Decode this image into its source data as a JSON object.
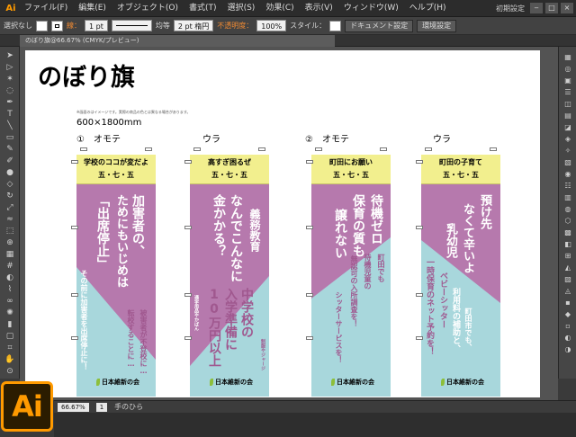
{
  "menubar": {
    "app_icon": "Ai",
    "items": [
      "ファイル(F)",
      "編集(E)",
      "オブジェクト(O)",
      "書式(T)",
      "選択(S)",
      "効果(C)",
      "表示(V)",
      "ウィンドウ(W)",
      "ヘルプ(H)"
    ],
    "workspace": "初期設定",
    "window_buttons": [
      "‒",
      "□",
      "×"
    ]
  },
  "controlbar": {
    "selection": "選択なし",
    "stroke_label": "線：",
    "stroke_weight": "1 pt",
    "profile": "均等",
    "brush": "2 pt 楕円",
    "opacity_label": "不透明度：",
    "opacity_value": "100%",
    "style_label": "スタイル：",
    "doc_settings": "ドキュメント設定",
    "env_settings": "環境設定"
  },
  "document": {
    "tab_title": "のぼり旗@66.67% (CMYK/プレビュー)"
  },
  "artboard": {
    "title": "のぼり旗",
    "note": "※画面のはイメージです。実際の商品の色とは異なる場合があります。",
    "size": "600×1800mm",
    "pairs": [
      {
        "num": "①",
        "front": "オモテ",
        "back": "ウラ"
      },
      {
        "num": "②",
        "front": "オモテ",
        "back": "ウラ"
      }
    ],
    "banners": [
      {
        "header1": "学校のココが変だよ",
        "header2": "五・七・五",
        "cols_white": [
          "加害者の、",
          "ためにもいじめは",
          "「出席停止」"
        ],
        "cols_bottom": [
          "その前に加害者を出席停止に！"
        ],
        "cols_pink": [
          "被害者が不登校に…",
          "転校することに…"
        ],
        "logo": "日本維新の会"
      },
      {
        "header1": "高すぎ困るぜ",
        "header2": "五・七・五",
        "cols_white": [
          "義務教育",
          "なんでこんなに",
          "金かかる？"
        ],
        "cols_bottom": [
          "中学校の",
          "入学準備に",
          "10万円以上"
        ],
        "small_left": "通学用品やかばん",
        "small_right": "制服やジャージ",
        "logo": "日本維新の会"
      },
      {
        "header1": "町田にお願い",
        "header2": "五・七・五",
        "cols_white": [
          "待機ゼロ",
          "保育の質も",
          "譲れない"
        ],
        "cols_pink": [
          "町田でも",
          "待機児童の",
          "無認可の入所調査を！"
        ],
        "cols_bottom": [
          "シッターサービスを！"
        ],
        "logo": "日本維新の会"
      },
      {
        "header1": "町田の子育て",
        "header2": "五・七・五",
        "cols_white": [
          "預け先",
          "なくて辛いよ",
          "乳幼児"
        ],
        "cols_bottom": [
          "一時保育のネット予約を！",
          "ベビーシッター",
          "利用料の補助と、"
        ],
        "cols_pink": [
          "町田市でも、"
        ],
        "logo": "日本維新の会"
      }
    ]
  },
  "statusbar": {
    "zoom": "66.67%",
    "page": "1",
    "tool": "手のひら"
  },
  "colors": {
    "banner_purple": "#b679ad",
    "banner_cyan": "#a8d7dc",
    "banner_yellow": "#f2ef8e",
    "ai_orange": "#ff9a00"
  },
  "icons": {
    "tools": [
      "selection-icon",
      "direct-selection-icon",
      "magic-wand-icon",
      "lasso-icon",
      "pen-icon",
      "type-icon",
      "line-icon",
      "rectangle-icon",
      "paintbrush-icon",
      "pencil-icon",
      "blob-brush-icon",
      "eraser-icon",
      "rotate-icon",
      "scale-icon",
      "width-icon",
      "free-transform-icon",
      "shape-builder-icon",
      "perspective-icon",
      "mesh-icon",
      "gradient-icon",
      "eyedropper-icon",
      "blend-icon",
      "symbol-sprayer-icon",
      "graph-icon",
      "artboard-icon",
      "slice-icon",
      "hand-icon",
      "zoom-icon"
    ]
  }
}
